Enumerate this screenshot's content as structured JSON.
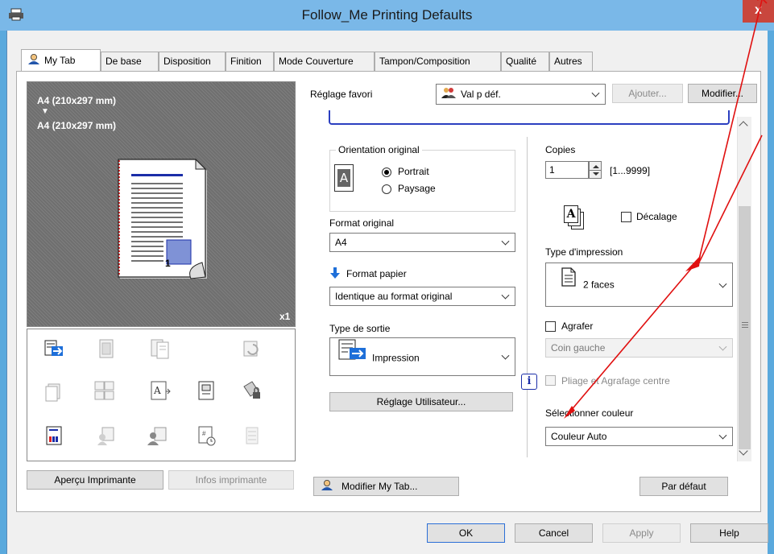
{
  "window": {
    "title": "Follow_Me Printing Defaults",
    "close_label": "x"
  },
  "tabs": [
    {
      "label": "My Tab",
      "active": true
    },
    {
      "label": "De base"
    },
    {
      "label": "Disposition"
    },
    {
      "label": "Finition"
    },
    {
      "label": "Mode Couverture"
    },
    {
      "label": "Tampon/Composition"
    },
    {
      "label": "Qualité"
    },
    {
      "label": "Autres"
    }
  ],
  "preview": {
    "paper_original": "A4 (210x297 mm)",
    "paper_output": "A4 (210x297 mm)",
    "arrow_glyph": "▼",
    "copies_badge": "x1",
    "page_number": "1"
  },
  "left_buttons": {
    "printer_view": "Aperçu Imprimante",
    "printer_info": "Infos imprimante"
  },
  "favorites": {
    "label": "Réglage favori",
    "value": "Val p déf.",
    "add": "Ajouter...",
    "modify": "Modifier..."
  },
  "orientation": {
    "group_label": "Orientation original",
    "portrait": "Portrait",
    "landscape": "Paysage",
    "icon_letter": "A"
  },
  "original_format": {
    "label": "Format original",
    "value": "A4"
  },
  "paper_format": {
    "label": "Format papier",
    "value": "Identique au format original"
  },
  "output_type": {
    "label": "Type de sortie",
    "value": "Impression"
  },
  "user_settings": "Réglage Utilisateur...",
  "copies": {
    "label": "Copies",
    "value": "1",
    "range": "[1...9999]"
  },
  "offset": {
    "label": "Décalage",
    "icon_letter": "A"
  },
  "print_type": {
    "label": "Type d'impression",
    "value": "2 faces"
  },
  "staple": {
    "label": "Agrafer",
    "position": "Coin gauche"
  },
  "fold_staple": {
    "label": "Pliage et Agrafage centre"
  },
  "info_glyph": "i",
  "color": {
    "label": "Sélectionner couleur",
    "value": "Couleur Auto"
  },
  "bottom": {
    "edit_mytab": "Modifier My Tab...",
    "default": "Par défaut",
    "ok": "OK",
    "cancel": "Cancel",
    "apply": "Apply",
    "help": "Help"
  },
  "colors": {
    "title_bar": "#7ab8e8",
    "close_button": "#c9463d",
    "annotation_red": "#e01010",
    "preview_bg": "#6f6f6f"
  }
}
